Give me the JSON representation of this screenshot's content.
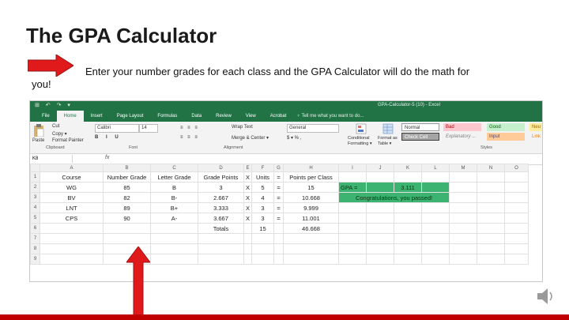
{
  "slide": {
    "title": "The GPA Calculator",
    "intro_line1": "Enter your number grades for each class and the GPA Calculator will do the math for",
    "intro_line2": "you!"
  },
  "colors": {
    "arrow": "#e0191b",
    "excel_green": "#217346",
    "highlight": "#3cb371",
    "footer": "#c00000"
  },
  "excel": {
    "window_title": "GPA-Calculator-5 (10) - Excel",
    "quick_access": "⊞ ↶ ↷ ▾",
    "tabs": [
      "File",
      "Home",
      "Insert",
      "Page Layout",
      "Formulas",
      "Data",
      "Review",
      "View",
      "Acrobat"
    ],
    "tell_me": "♀ Tell me what you want to do...",
    "ribbon": {
      "paste": "Paste",
      "cut": "Cut",
      "copy": "Copy ▾",
      "format_painter": "Format Painter",
      "clipboard": "Clipboard",
      "font_name": "Calibri",
      "font_size": "14",
      "font_group": "Font",
      "wrap_text": "Wrap Text",
      "merge_center": "Merge & Center ▾",
      "alignment_group": "Alignment",
      "number_format": "General",
      "conditional_formatting": "Conditional Formatting ▾",
      "format_as_table": "Format as Table ▾",
      "styles_group": "Styles",
      "style_normal": "Normal",
      "style_bad": "Bad",
      "style_good": "Good",
      "style_neutral": "Neu",
      "style_check": "Check Cell",
      "style_explanatory": "Explanatory ...",
      "style_input": "Input",
      "style_link": "Link"
    },
    "name_box": "K8",
    "fx": "fx",
    "columns": [
      "",
      "A",
      "B",
      "C",
      "D",
      "E",
      "F",
      "G",
      "H",
      "I",
      "J",
      "K",
      "L",
      "M",
      "N",
      "O"
    ],
    "rows": [
      [
        "1",
        "Course",
        "Number Grade",
        "Letter Grade",
        "Grade Points",
        "X",
        "Units",
        "=",
        "Points per Class",
        "",
        "",
        "",
        "",
        "",
        "",
        ""
      ],
      [
        "2",
        "WG",
        "85",
        "B",
        "3",
        "X",
        "5",
        "=",
        "15",
        "GPA =",
        "",
        "3.111",
        "",
        "",
        "",
        ""
      ],
      [
        "3",
        "BV",
        "82",
        "B-",
        "2.667",
        "X",
        "4",
        "=",
        "10.668",
        "Congratulations, you passed!",
        "",
        "",
        "",
        "",
        "",
        ""
      ],
      [
        "4",
        "LNT",
        "89",
        "B+",
        "3.333",
        "X",
        "3",
        "=",
        "9.999",
        "",
        "",
        "",
        "",
        "",
        "",
        ""
      ],
      [
        "5",
        "CPS",
        "90",
        "A-",
        "3.667",
        "X",
        "3",
        "=",
        "11.001",
        "",
        "",
        "",
        "",
        "",
        "",
        ""
      ],
      [
        "6",
        "",
        "",
        "",
        "Totals",
        "",
        "15",
        "",
        "46.668",
        "",
        "",
        "",
        "",
        "",
        "",
        ""
      ],
      [
        "7",
        "",
        "",
        "",
        "",
        "",
        "",
        "",
        "",
        "",
        "",
        "",
        "",
        "",
        "",
        ""
      ],
      [
        "8",
        "",
        "",
        "",
        "",
        "",
        "",
        "",
        "",
        "",
        "",
        "",
        "",
        "",
        "",
        ""
      ],
      [
        "9",
        "",
        "",
        "",
        "",
        "",
        "",
        "",
        "",
        "",
        "",
        "",
        "",
        "",
        "",
        ""
      ]
    ]
  }
}
